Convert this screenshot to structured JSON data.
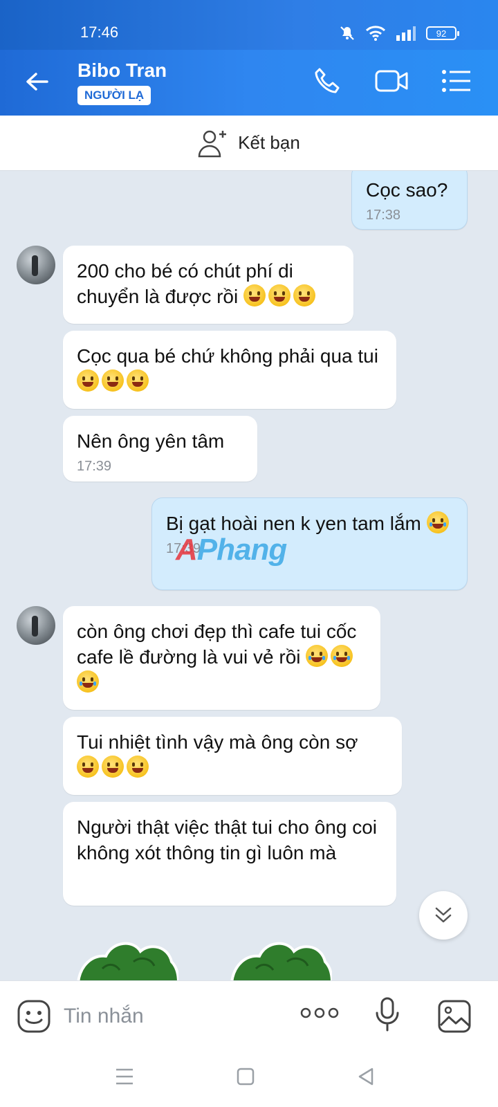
{
  "status_bar": {
    "time": "17:46",
    "battery": "92"
  },
  "header": {
    "name": "Bibo Tran",
    "badge": "NGƯỜI LẠ"
  },
  "add_friend": {
    "label": "Kết bạn"
  },
  "messages": [
    {
      "dir": "out",
      "text": "Cọc sao?",
      "time": "17:38"
    },
    {
      "dir": "in",
      "text": "200 cho bé có chút phí di chuyển là được rồi"
    },
    {
      "dir": "in",
      "text": "Cọc qua bé chứ không phải qua tui"
    },
    {
      "dir": "in",
      "text": "Nên ông yên tâm",
      "time": "17:39"
    },
    {
      "dir": "out",
      "text": "Bị gạt hoài nen k yen tam lắm",
      "time": "17:39"
    },
    {
      "dir": "in",
      "text": "còn ông chơi đẹp thì cafe tui cốc cafe lề đường là vui vẻ rồi"
    },
    {
      "dir": "in",
      "text": "Tui nhiệt tình vậy mà ông còn sợ"
    },
    {
      "dir": "in",
      "text": "Người thật việc thật tui cho ông coi không xót thông tin gì luôn mà"
    }
  ],
  "watermark": {
    "text": "Phang",
    "first": "A"
  },
  "input": {
    "placeholder": "Tin nhắn"
  },
  "colors": {
    "header": "#2a86ef",
    "outgoing_bubble": "#d3ecfd",
    "background": "#e1e8f0"
  }
}
